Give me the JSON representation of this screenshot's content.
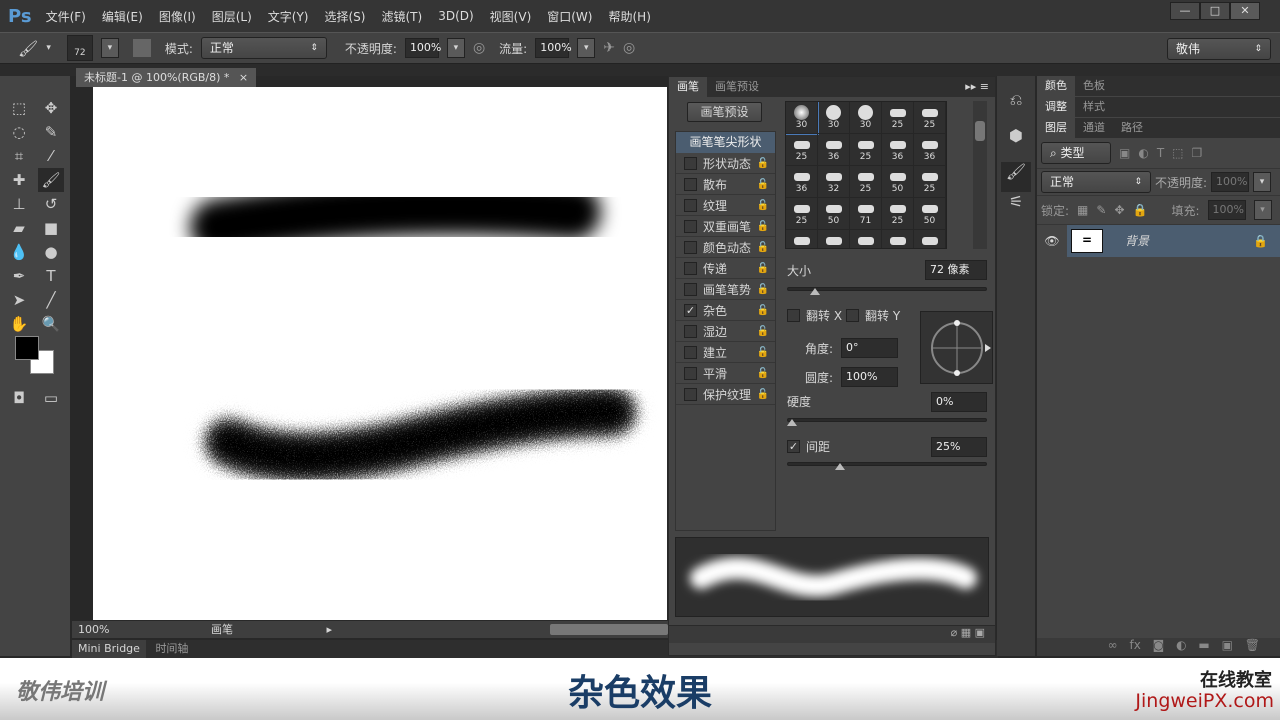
{
  "app": {
    "logo": "Ps",
    "menus": [
      "文件(F)",
      "编辑(E)",
      "图像(I)",
      "图层(L)",
      "文字(Y)",
      "选择(S)",
      "滤镜(T)",
      "3D(D)",
      "视图(V)",
      "窗口(W)",
      "帮助(H)"
    ],
    "window_buttons": [
      "—",
      "□",
      "✕"
    ]
  },
  "options": {
    "brush_size": "72",
    "mode_label": "模式:",
    "mode_value": "正常",
    "opacity_label": "不透明度:",
    "opacity_value": "100%",
    "flow_label": "流量:",
    "flow_value": "100%",
    "workspace": "敬伟"
  },
  "document": {
    "tab_title": "未标题-1 @ 100%(RGB/8) *",
    "close": "×",
    "zoom": "100%",
    "status_text": "画笔"
  },
  "bottom_tabs": [
    "Mini Bridge",
    "时间轴"
  ],
  "brush_panel": {
    "tabs": [
      "画笔",
      "画笔预设"
    ],
    "preset_button": "画笔预设",
    "tip_shape": "画笔笔尖形状",
    "options": [
      {
        "label": "形状动态",
        "checked": false
      },
      {
        "label": "散布",
        "checked": false
      },
      {
        "label": "纹理",
        "checked": false
      },
      {
        "label": "双重画笔",
        "checked": false
      },
      {
        "label": "颜色动态",
        "checked": false
      },
      {
        "label": "传递",
        "checked": false
      },
      {
        "label": "画笔笔势",
        "checked": false
      },
      {
        "label": "杂色",
        "checked": true
      },
      {
        "label": "湿边",
        "checked": false
      },
      {
        "label": "建立",
        "checked": false
      },
      {
        "label": "平滑",
        "checked": false
      },
      {
        "label": "保护纹理",
        "checked": false
      }
    ],
    "brush_sizes": [
      "30",
      "30",
      "30",
      "25",
      "25",
      "25",
      "36",
      "25",
      "36",
      "36",
      "36",
      "32",
      "25",
      "50",
      "25",
      "25",
      "50",
      "71",
      "25",
      "50",
      "",
      "",
      "",
      "",
      ""
    ],
    "size_label": "大小",
    "size_value": "72 像素",
    "size_slider": 0.12,
    "flip_x": "翻转 X",
    "flip_y": "翻转 Y",
    "angle_label": "角度:",
    "angle_value": "0°",
    "roundness_label": "圆度:",
    "roundness_value": "100%",
    "hardness_label": "硬度",
    "hardness_value": "0%",
    "hardness_slider": 0,
    "spacing_label": "间距",
    "spacing_checked": true,
    "spacing_value": "25%",
    "spacing_slider": 0.25
  },
  "right_panels": {
    "group1": [
      "颜色",
      "色板"
    ],
    "group2": [
      "调整",
      "样式"
    ],
    "group3": [
      "图层",
      "通道",
      "路径"
    ],
    "filter_label": "类型",
    "blend_mode": "正常",
    "opacity_label": "不透明度:",
    "opacity_value": "100%",
    "lock_label": "锁定:",
    "fill_label": "填充:",
    "fill_value": "100%",
    "layer_name": "背景"
  },
  "banner": {
    "left_logo": "敬伟培训",
    "title": "杂色效果",
    "right_line1": "在线教室",
    "right_line2": "JingweiPX.com"
  },
  "colors": {
    "accent": "#5a9bd5",
    "selected_row": "#4b5d70",
    "banner_title": "#1a3d66",
    "banner_url": "#b01818"
  }
}
